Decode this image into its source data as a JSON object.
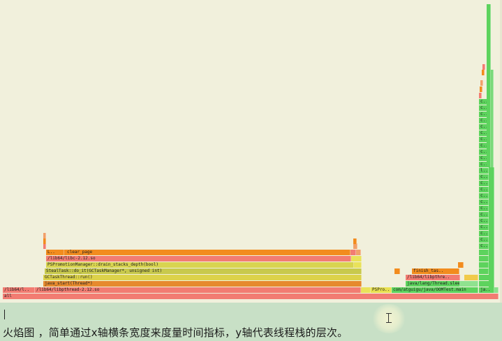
{
  "caption": "火焰图 ，简单通过x轴横条宽度来度量时间指标，y轴代表线程栈的层次。",
  "palette": {
    "background": "#f1f0dc",
    "status_bar": "#c8e0c6",
    "red": "#f27c72",
    "orange": "#f28c1e",
    "yellow": "#dcd24a",
    "olive": "#c8c94c",
    "green": "#5dd35d"
  },
  "frames": [
    {
      "label": "all",
      "color": "#f27c72"
    },
    {
      "label": "/lib64/l..",
      "color": "#f27c72"
    },
    {
      "label": "/lib64/libpthread-2.12.so",
      "color": "#f27c72"
    },
    {
      "label": "PSPro..",
      "color": "#e8e050"
    },
    {
      "label": "com/atguigu/java/OOMTest.main",
      "color": "#5dd35d"
    },
    {
      "label": "ja..",
      "color": "#5dd35d"
    },
    {
      "label": "java_start(Thread*)",
      "color": "#e68a2e"
    },
    {
      "label": "java/lang/Thread.sleep",
      "color": "#5dd35d"
    },
    {
      "label": "GCTaskThread::run()",
      "color": "#dcd24a"
    },
    {
      "label": "/lib64/libpthre..",
      "color": "#f27c72"
    },
    {
      "label": "StealTask::do_it(GCTaskManager*, unsigned int)",
      "color": "#c8c94c"
    },
    {
      "label": "finish_tas..",
      "color": "#f28c1e"
    },
    {
      "label": "PSPromotionManager::drain_stacks_depth(bool)",
      "color": "#d8d450"
    },
    {
      "label": "/lib64/libc-2.12.so",
      "color": "#f27c72"
    },
    {
      "label": "L..",
      "color": "#f28c1e"
    },
    {
      "label": "clear_page",
      "color": "#f28c1e"
    },
    {
      "label": "c..",
      "color": "#5dd35d"
    },
    {
      "label": "l..",
      "color": "#5dd35d"
    }
  ]
}
